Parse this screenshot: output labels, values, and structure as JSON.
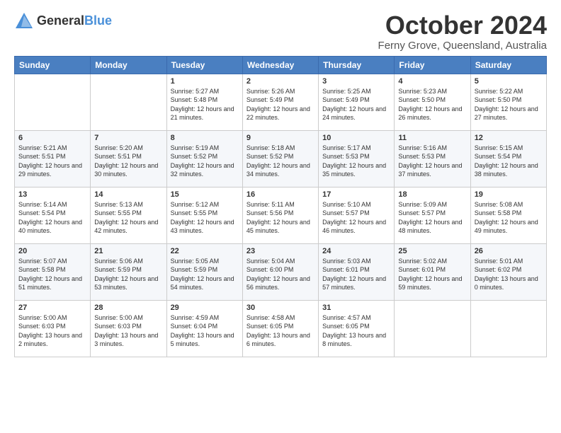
{
  "logo": {
    "general": "General",
    "blue": "Blue"
  },
  "title": "October 2024",
  "location": "Ferny Grove, Queensland, Australia",
  "weekdays": [
    "Sunday",
    "Monday",
    "Tuesday",
    "Wednesday",
    "Thursday",
    "Friday",
    "Saturday"
  ],
  "weeks": [
    [
      {
        "day": "",
        "info": ""
      },
      {
        "day": "",
        "info": ""
      },
      {
        "day": "1",
        "info": "Sunrise: 5:27 AM\nSunset: 5:48 PM\nDaylight: 12 hours and 21 minutes."
      },
      {
        "day": "2",
        "info": "Sunrise: 5:26 AM\nSunset: 5:49 PM\nDaylight: 12 hours and 22 minutes."
      },
      {
        "day": "3",
        "info": "Sunrise: 5:25 AM\nSunset: 5:49 PM\nDaylight: 12 hours and 24 minutes."
      },
      {
        "day": "4",
        "info": "Sunrise: 5:23 AM\nSunset: 5:50 PM\nDaylight: 12 hours and 26 minutes."
      },
      {
        "day": "5",
        "info": "Sunrise: 5:22 AM\nSunset: 5:50 PM\nDaylight: 12 hours and 27 minutes."
      }
    ],
    [
      {
        "day": "6",
        "info": "Sunrise: 5:21 AM\nSunset: 5:51 PM\nDaylight: 12 hours and 29 minutes."
      },
      {
        "day": "7",
        "info": "Sunrise: 5:20 AM\nSunset: 5:51 PM\nDaylight: 12 hours and 30 minutes."
      },
      {
        "day": "8",
        "info": "Sunrise: 5:19 AM\nSunset: 5:52 PM\nDaylight: 12 hours and 32 minutes."
      },
      {
        "day": "9",
        "info": "Sunrise: 5:18 AM\nSunset: 5:52 PM\nDaylight: 12 hours and 34 minutes."
      },
      {
        "day": "10",
        "info": "Sunrise: 5:17 AM\nSunset: 5:53 PM\nDaylight: 12 hours and 35 minutes."
      },
      {
        "day": "11",
        "info": "Sunrise: 5:16 AM\nSunset: 5:53 PM\nDaylight: 12 hours and 37 minutes."
      },
      {
        "day": "12",
        "info": "Sunrise: 5:15 AM\nSunset: 5:54 PM\nDaylight: 12 hours and 38 minutes."
      }
    ],
    [
      {
        "day": "13",
        "info": "Sunrise: 5:14 AM\nSunset: 5:54 PM\nDaylight: 12 hours and 40 minutes."
      },
      {
        "day": "14",
        "info": "Sunrise: 5:13 AM\nSunset: 5:55 PM\nDaylight: 12 hours and 42 minutes."
      },
      {
        "day": "15",
        "info": "Sunrise: 5:12 AM\nSunset: 5:55 PM\nDaylight: 12 hours and 43 minutes."
      },
      {
        "day": "16",
        "info": "Sunrise: 5:11 AM\nSunset: 5:56 PM\nDaylight: 12 hours and 45 minutes."
      },
      {
        "day": "17",
        "info": "Sunrise: 5:10 AM\nSunset: 5:57 PM\nDaylight: 12 hours and 46 minutes."
      },
      {
        "day": "18",
        "info": "Sunrise: 5:09 AM\nSunset: 5:57 PM\nDaylight: 12 hours and 48 minutes."
      },
      {
        "day": "19",
        "info": "Sunrise: 5:08 AM\nSunset: 5:58 PM\nDaylight: 12 hours and 49 minutes."
      }
    ],
    [
      {
        "day": "20",
        "info": "Sunrise: 5:07 AM\nSunset: 5:58 PM\nDaylight: 12 hours and 51 minutes."
      },
      {
        "day": "21",
        "info": "Sunrise: 5:06 AM\nSunset: 5:59 PM\nDaylight: 12 hours and 53 minutes."
      },
      {
        "day": "22",
        "info": "Sunrise: 5:05 AM\nSunset: 5:59 PM\nDaylight: 12 hours and 54 minutes."
      },
      {
        "day": "23",
        "info": "Sunrise: 5:04 AM\nSunset: 6:00 PM\nDaylight: 12 hours and 56 minutes."
      },
      {
        "day": "24",
        "info": "Sunrise: 5:03 AM\nSunset: 6:01 PM\nDaylight: 12 hours and 57 minutes."
      },
      {
        "day": "25",
        "info": "Sunrise: 5:02 AM\nSunset: 6:01 PM\nDaylight: 12 hours and 59 minutes."
      },
      {
        "day": "26",
        "info": "Sunrise: 5:01 AM\nSunset: 6:02 PM\nDaylight: 13 hours and 0 minutes."
      }
    ],
    [
      {
        "day": "27",
        "info": "Sunrise: 5:00 AM\nSunset: 6:03 PM\nDaylight: 13 hours and 2 minutes."
      },
      {
        "day": "28",
        "info": "Sunrise: 5:00 AM\nSunset: 6:03 PM\nDaylight: 13 hours and 3 minutes."
      },
      {
        "day": "29",
        "info": "Sunrise: 4:59 AM\nSunset: 6:04 PM\nDaylight: 13 hours and 5 minutes."
      },
      {
        "day": "30",
        "info": "Sunrise: 4:58 AM\nSunset: 6:05 PM\nDaylight: 13 hours and 6 minutes."
      },
      {
        "day": "31",
        "info": "Sunrise: 4:57 AM\nSunset: 6:05 PM\nDaylight: 13 hours and 8 minutes."
      },
      {
        "day": "",
        "info": ""
      },
      {
        "day": "",
        "info": ""
      }
    ]
  ]
}
